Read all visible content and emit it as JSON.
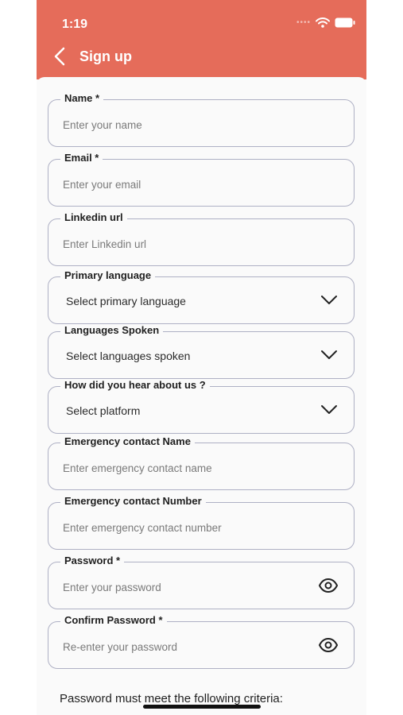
{
  "status_bar": {
    "time": "1:19"
  },
  "header": {
    "title": "Sign up"
  },
  "fields": {
    "name": {
      "label": "Name *",
      "placeholder": "Enter your name"
    },
    "email": {
      "label": "Email *",
      "placeholder": "Enter your email"
    },
    "linkedin": {
      "label": "Linkedin url",
      "placeholder": "Enter Linkedin url"
    },
    "primary_language": {
      "label": "Primary language",
      "value": "Select primary language"
    },
    "languages_spoken": {
      "label": "Languages Spoken",
      "value": "Select languages spoken"
    },
    "hear_about": {
      "label": "How did you hear about us ?",
      "value": "Select platform"
    },
    "emergency_name": {
      "label": "Emergency contact Name",
      "placeholder": "Enter emergency contact name"
    },
    "emergency_number": {
      "label": "Emergency contact Number",
      "placeholder": "Enter emergency contact number"
    },
    "password": {
      "label": "Password *",
      "placeholder": "Enter your password"
    },
    "confirm_password": {
      "label": "Confirm Password *",
      "placeholder": "Re-enter your password"
    }
  },
  "criteria_text": "Password must meet the following criteria:",
  "colors": {
    "header_bg": "#e56c5a",
    "border": "#aeb0c4"
  }
}
